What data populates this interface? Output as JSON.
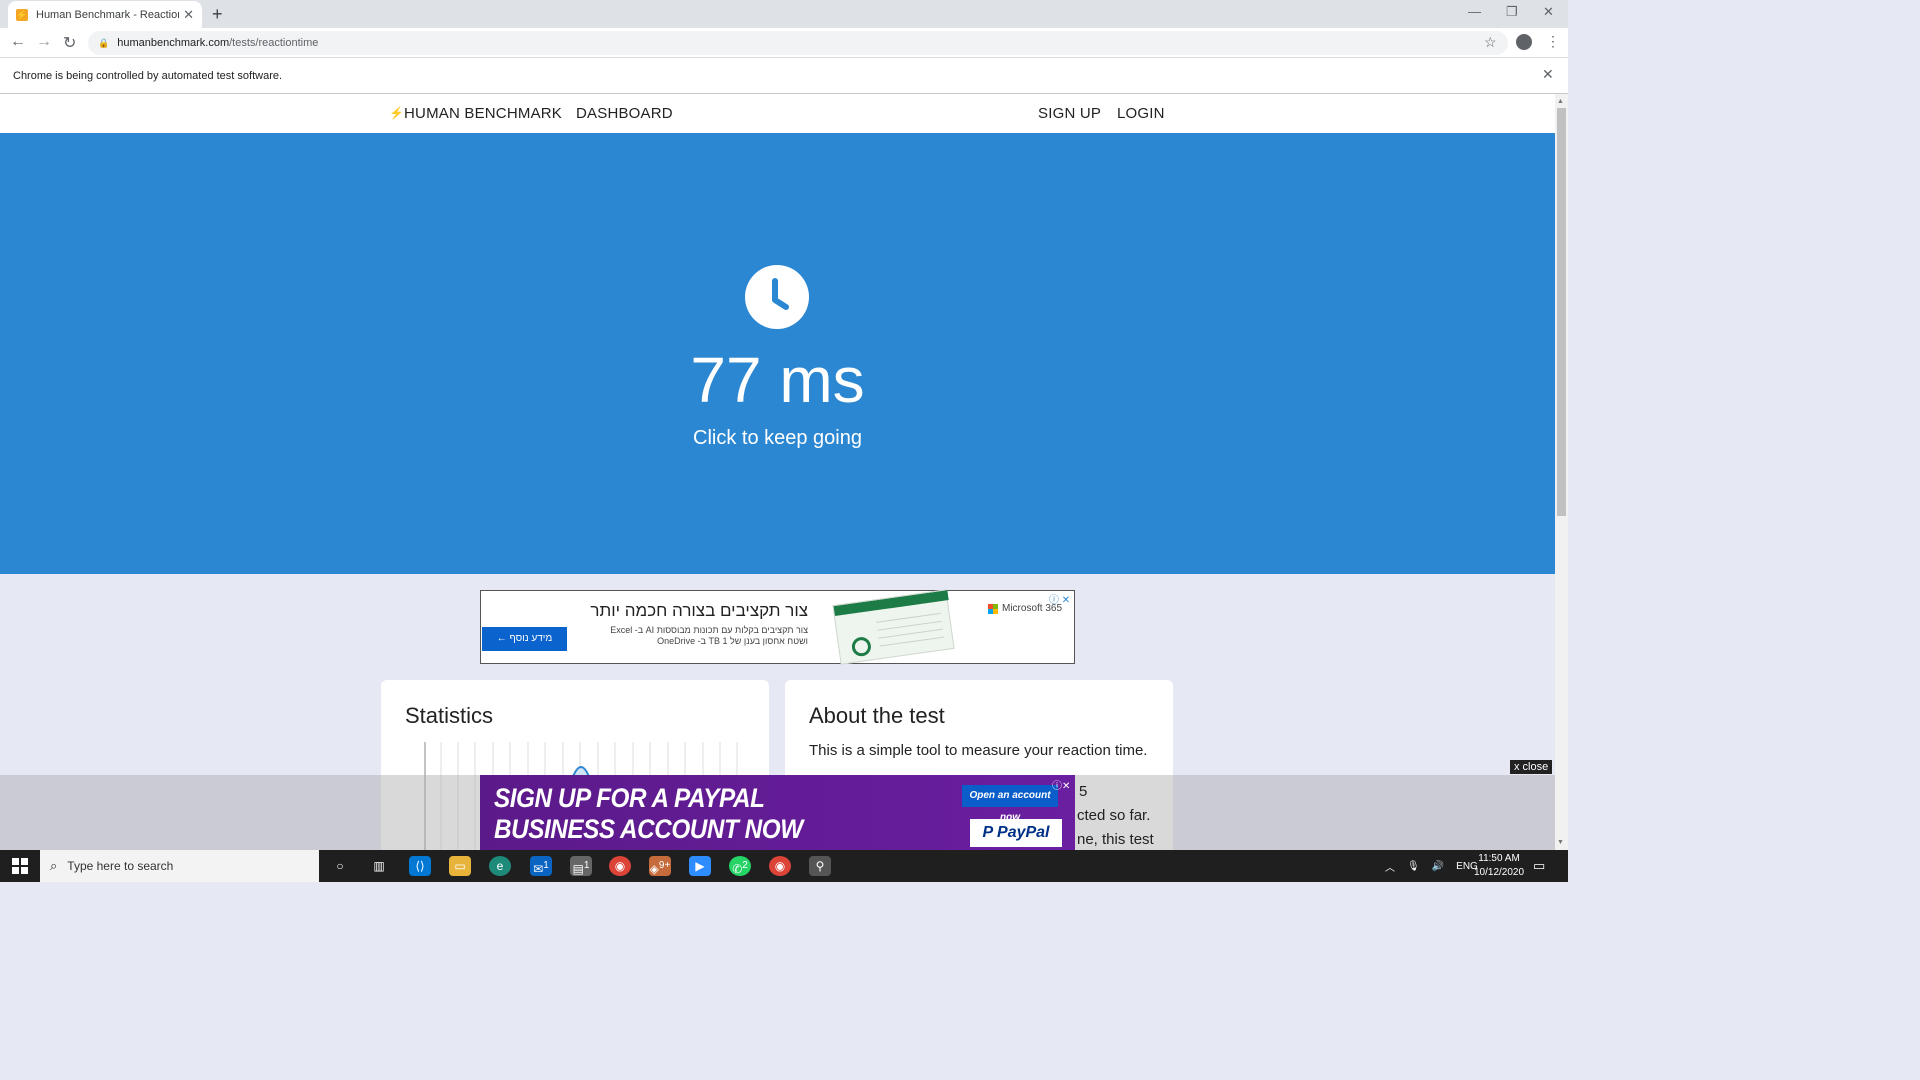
{
  "browser": {
    "tab_title": "Human Benchmark - Reaction Ti",
    "tab_favicon": "⚡",
    "url_domain": "humanbenchmark.com",
    "url_path": "/tests/reactiontime",
    "infobar_text": "Chrome is being controlled by automated test software."
  },
  "site_nav": {
    "brand": "HUMAN BENCHMARK",
    "dashboard": "DASHBOARD",
    "signup": "SIGN UP",
    "login": "LOGIN"
  },
  "test": {
    "result": "77 ms",
    "prompt": "Click to keep going",
    "accent_color": "#2b87d1"
  },
  "ad_top": {
    "headline": "צור תקציבים בצורה חכמה יותר",
    "subtext_line1": "צור תקציבים בקלות עם תכונות מבוססות AI ב- Excel",
    "subtext_line2": "ושטח אחסון בענן של 1 TB ב- OneDrive",
    "button_label": "מידע נוסף",
    "brand": "Microsoft 365"
  },
  "cards": {
    "statistics_title": "Statistics",
    "about_title": "About the test",
    "about_line1": "This is a simple tool to measure your reaction time.",
    "about_fragment1": "5",
    "about_fragment2": "cted so far.",
    "about_fragment3": "ne, this test"
  },
  "ad_bottom": {
    "headline_line1": "SIGN UP FOR A PAYPAL",
    "headline_line2": "BUSINESS ACCOUNT NOW",
    "cta": "Open an account now",
    "brand": "PayPal",
    "close_label": "x close"
  },
  "taskbar": {
    "search_placeholder": "Type here to search",
    "language": "ENG",
    "time": "11:50 AM",
    "date": "10/12/2020",
    "badges": {
      "mail": "1",
      "files": "1",
      "teams": "9+",
      "whatsapp": "2"
    }
  }
}
